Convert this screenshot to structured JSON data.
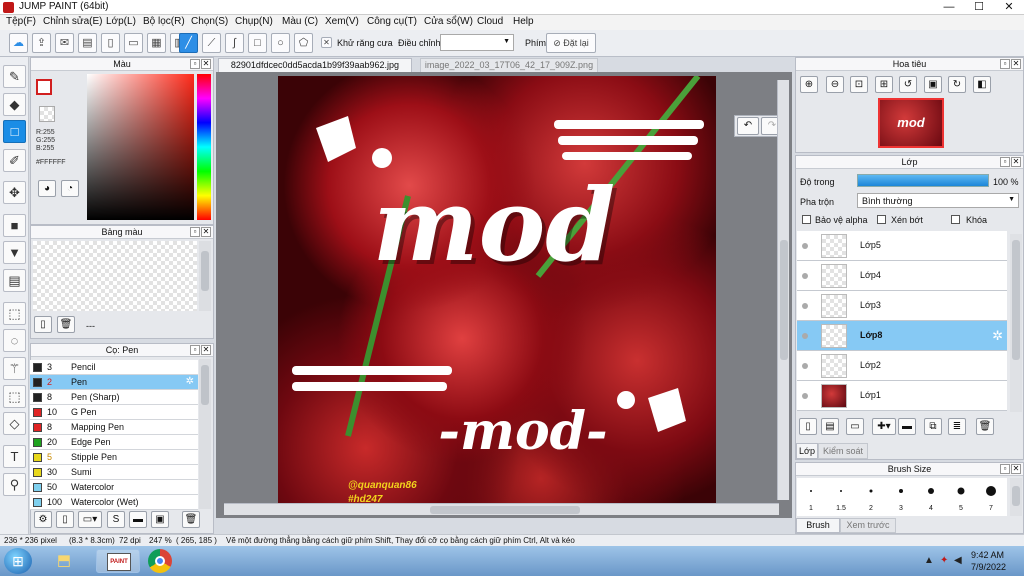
{
  "window": {
    "title": "JUMP PAINT (64bit)"
  },
  "menu": [
    "Tệp(F)",
    "Chỉnh sửa(E)",
    "Lớp(L)",
    "Bộ lọc(R)",
    "Chọn(S)",
    "Chụp(N)",
    "Màu (C)",
    "Xem(V)",
    "Công cụ(T)",
    "Cửa sổ(W)",
    "Cloud",
    "Help"
  ],
  "toolbar": {
    "antialias_label": "Khử răng cưa",
    "adjust_label": "Điều chỉnh",
    "key_label": "Phím",
    "reset_label": "Đặt lại"
  },
  "color_panel": {
    "title": "Màu",
    "r": "R:255",
    "g": "G:255",
    "b": "B:255",
    "hex": "#FFFFFF"
  },
  "palette_panel": {
    "title": "Bảng màu",
    "footer_text": "---"
  },
  "brush_panel": {
    "title": "Cọ: Pen",
    "items": [
      {
        "size": "3",
        "name": "Pencil",
        "color": "#222222"
      },
      {
        "size": "2",
        "name": "Pen",
        "color": "#222222",
        "size_color": "#d11f1f"
      },
      {
        "size": "8",
        "name": "Pen (Sharp)",
        "color": "#222222"
      },
      {
        "size": "10",
        "name": "G Pen",
        "color": "#e02424"
      },
      {
        "size": "8",
        "name": "Mapping Pen",
        "color": "#e02424"
      },
      {
        "size": "20",
        "name": "Edge Pen",
        "color": "#1fa31f"
      },
      {
        "size": "5",
        "name": "Stipple Pen",
        "color": "#e8d81b",
        "size_color": "#c98a00"
      },
      {
        "size": "30",
        "name": "Sumi",
        "color": "#e8d81b"
      },
      {
        "size": "50",
        "name": "Watercolor",
        "color": "#7fd0ee"
      },
      {
        "size": "100",
        "name": "Watercolor (Wet)",
        "color": "#7fd0ee"
      }
    ]
  },
  "tabs": [
    "82901dfdcec0dd5acda1b99f39aab962.jpg",
    "image_2022_03_17T06_42_17_909Z.png"
  ],
  "artwork": {
    "main_text": "mod",
    "sub_text": "-mod-",
    "credit1": "@quanquan86",
    "credit2": "#hd247"
  },
  "navigator": {
    "title": "Hoa tiêu"
  },
  "layer_panel": {
    "title": "Lớp",
    "opacity_label": "Độ trong",
    "opacity_value": "100 %",
    "opacity_fraction": 1.0,
    "blend_label": "Pha trộn",
    "blend_value": "Bình thường",
    "protect_alpha": "Bảo vệ alpha",
    "clip": "Xén bớt",
    "lock": "Khóa",
    "layers": [
      "Lớp5",
      "Lớp4",
      "Lớp3",
      "Lớp8",
      "Lớp2",
      "Lớp1"
    ],
    "tab1": "Lớp",
    "tab2": "Kiểm soát cọ"
  },
  "brush_size_panel": {
    "title": "Brush Size",
    "sizes": [
      "1",
      "1.5",
      "2",
      "3",
      "4",
      "5",
      "7"
    ],
    "tab1": "Brush Size",
    "tab2": "Xem trước cọ"
  },
  "status": {
    "size": "236 * 236 pixel",
    "cm": "(8.3 * 8.3cm)",
    "dpi": "72 dpi",
    "zoom": "247 %",
    "coords": "( 265, 185 )",
    "hint": "Vẽ một đường thẳng bằng cách giữ phím Shift, Thay đổi cỡ cọ bằng cách giữ phím Ctrl, Alt và kéo"
  },
  "taskbar": {
    "time": "9:42 AM",
    "date": "7/9/2022",
    "paint_label": "PAINT"
  },
  "colors": {
    "accent": "#2d8ee6",
    "active_row": "#86c9f4"
  }
}
